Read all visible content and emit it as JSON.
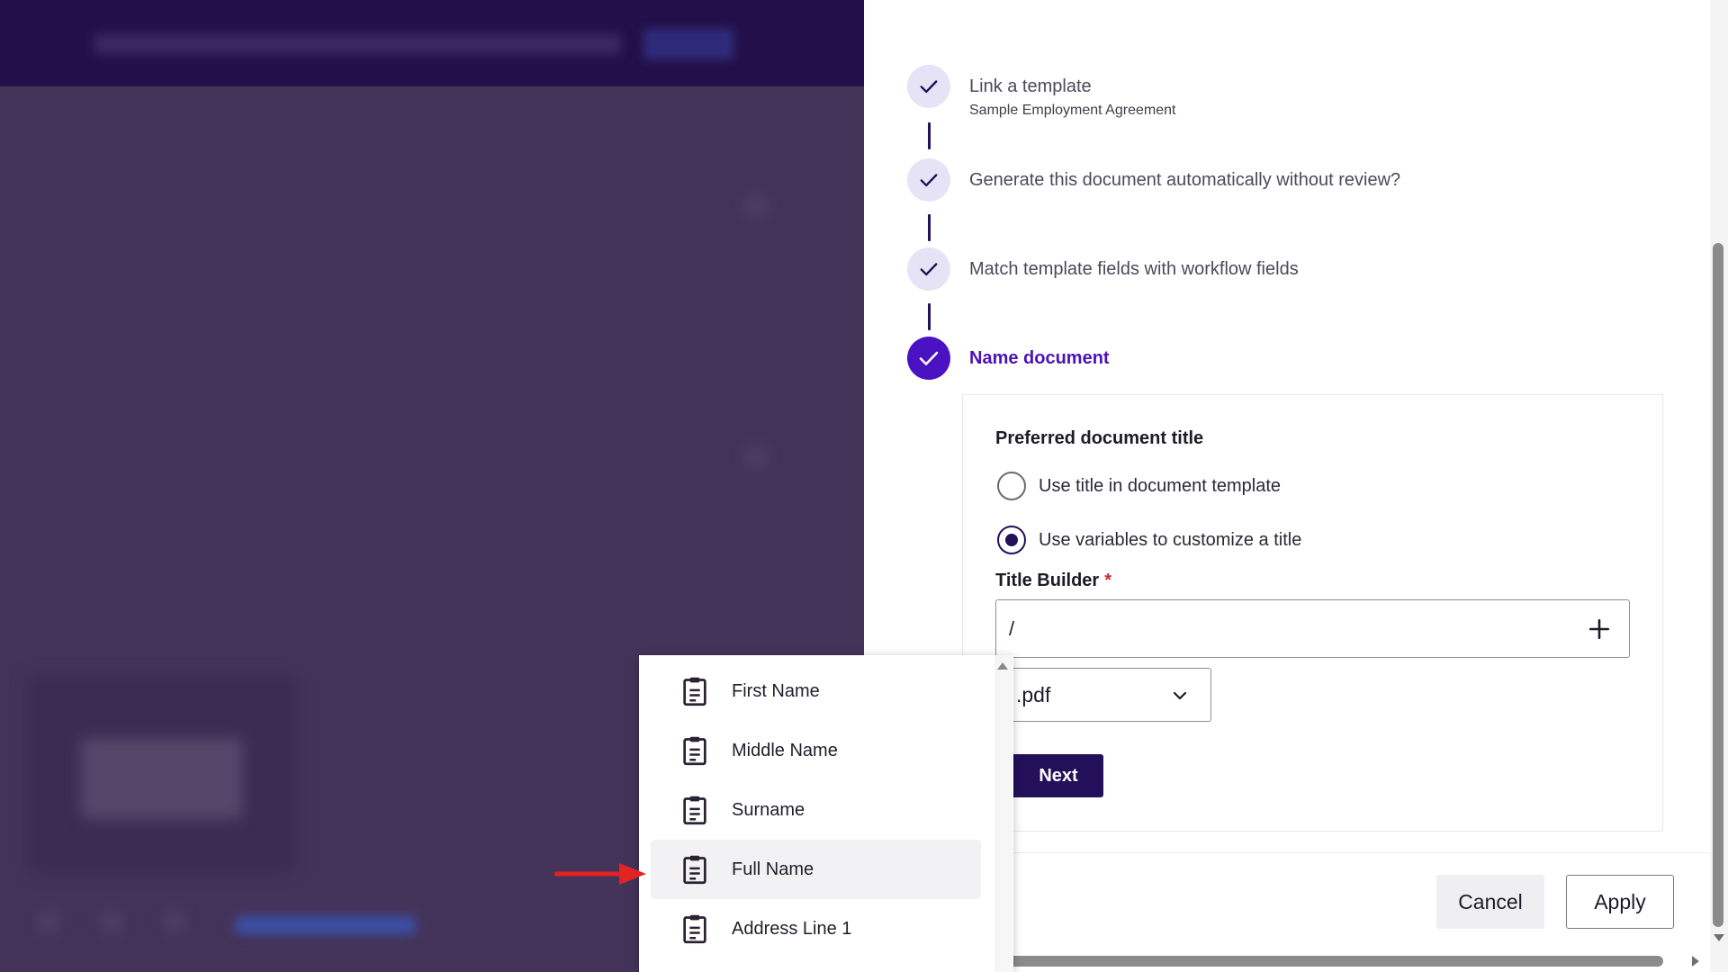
{
  "steps": [
    {
      "label": "Link a template",
      "sub": "Sample Employment Agreement",
      "status": "done"
    },
    {
      "label": "Generate this document automatically without review?",
      "status": "done"
    },
    {
      "label": "Match template fields with workflow fields",
      "status": "done"
    },
    {
      "label": "Name document",
      "status": "active"
    }
  ],
  "name_document": {
    "section_title": "Preferred document title",
    "options": [
      {
        "label": "Use title in document template",
        "checked": false
      },
      {
        "label": "Use variables to customize a title",
        "checked": true
      }
    ],
    "title_builder_label": "Title Builder",
    "required_marker": "*",
    "title_builder_value": "/",
    "extension_value": ".pdf",
    "next_label": "Next"
  },
  "footer": {
    "cancel_label": "Cancel",
    "apply_label": "Apply"
  },
  "variable_menu": {
    "items": [
      "First Name",
      "Middle Name",
      "Surname",
      "Full Name",
      "Address Line 1"
    ],
    "highlighted": "Full Name"
  },
  "colors": {
    "accent": "#4b12c3",
    "dark": "#24105a",
    "annotation": "#e32222"
  },
  "icons": [
    "check-icon",
    "plus-icon",
    "chevron-down-icon",
    "clipboard-icon",
    "arrow-right-icon"
  ]
}
